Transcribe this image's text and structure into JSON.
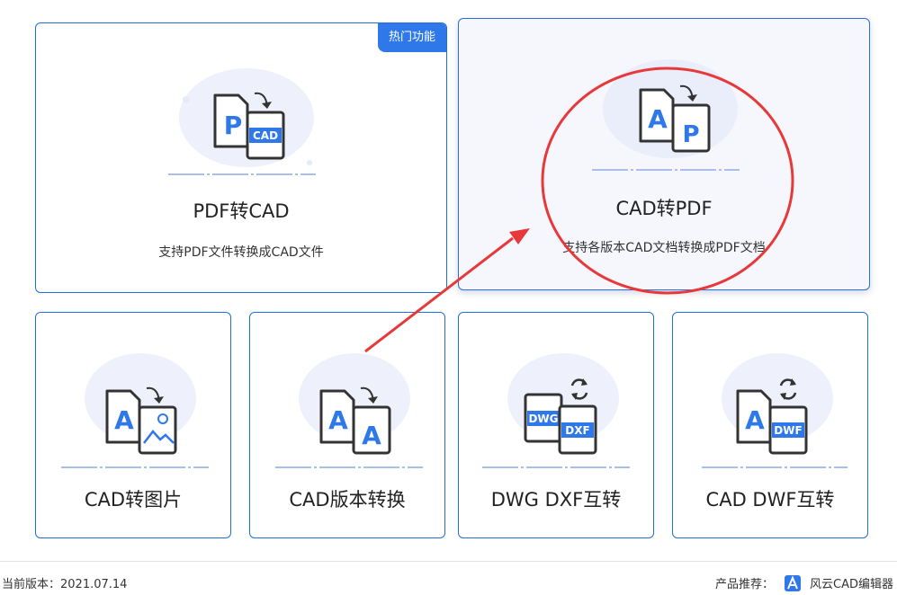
{
  "badge_hot": "热门功能",
  "cards": [
    {
      "title": "PDF转CAD",
      "desc": "支持PDF文件转换成CAD文件",
      "icon_left": "P",
      "icon_right": "CAD"
    },
    {
      "title": "CAD转PDF",
      "desc": "支持各版本CAD文档转换成PDF文档",
      "icon_left": "A",
      "icon_right": "P"
    },
    {
      "title": "CAD转图片",
      "icon_left": "A",
      "icon_right": "image"
    },
    {
      "title": "CAD版本转换",
      "icon_left": "A",
      "icon_right": "A"
    },
    {
      "title": "DWG DXF互转",
      "icon_left": "DWG",
      "icon_right": "DXF"
    },
    {
      "title": "CAD DWF互转",
      "icon_left": "A",
      "icon_right": "DWF"
    }
  ],
  "footer": {
    "version_label": "当前版本：",
    "version": "2021.07.14",
    "recommend_label": "产品推荐：",
    "product": "风云CAD编辑器"
  },
  "colors": {
    "accent": "#2f78ea",
    "annotation": "#e8393a"
  }
}
